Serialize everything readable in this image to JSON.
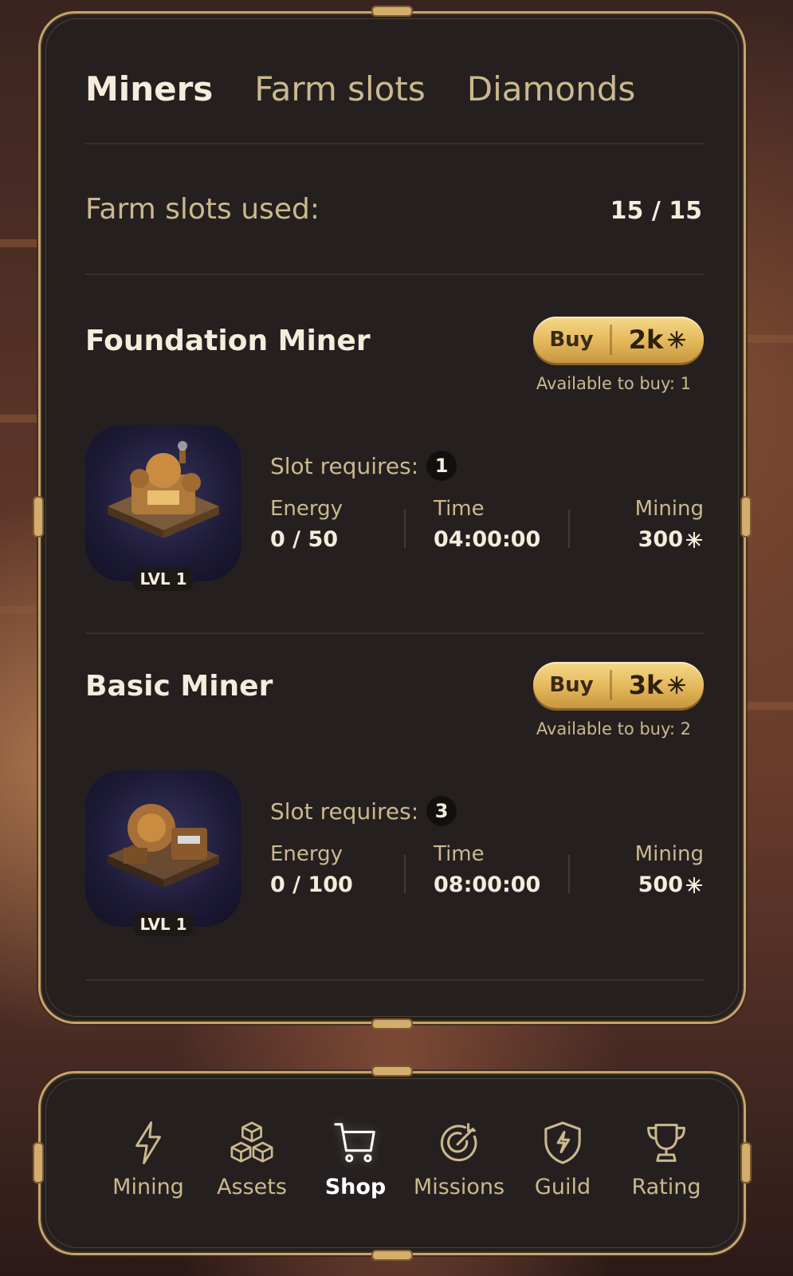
{
  "tabs": [
    {
      "label": "Miners",
      "active": true
    },
    {
      "label": "Farm slots",
      "active": false
    },
    {
      "label": "Diamonds",
      "active": false
    }
  ],
  "farm_slots": {
    "label": "Farm slots used:",
    "value": "15 / 15"
  },
  "miners": [
    {
      "name": "Foundation Miner",
      "buy_label": "Buy",
      "price": "2k",
      "available": "Available to buy: 1",
      "level": "LVL 1",
      "slot_label": "Slot requires:",
      "slot_value": "1",
      "energy_label": "Energy",
      "energy_value": "0 / 50",
      "time_label": "Time",
      "time_value": "04:00:00",
      "mining_label": "Mining",
      "mining_value": "300"
    },
    {
      "name": "Basic Miner",
      "buy_label": "Buy",
      "price": "3k",
      "available": "Available to buy: 2",
      "level": "LVL 1",
      "slot_label": "Slot requires:",
      "slot_value": "3",
      "energy_label": "Energy",
      "energy_value": "0 / 100",
      "time_label": "Time",
      "time_value": "08:00:00",
      "mining_label": "Mining",
      "mining_value": "500"
    }
  ],
  "nav": [
    {
      "label": "Mining",
      "icon": "lightning-icon",
      "active": false
    },
    {
      "label": "Assets",
      "icon": "cubes-icon",
      "active": false
    },
    {
      "label": "Shop",
      "icon": "cart-icon",
      "active": true
    },
    {
      "label": "Missions",
      "icon": "target-icon",
      "active": false
    },
    {
      "label": "Guild",
      "icon": "shield-icon",
      "active": false
    },
    {
      "label": "Rating",
      "icon": "trophy-icon",
      "active": false
    }
  ],
  "colors": {
    "accent_gold": "#e3b75a",
    "panel_bg": "#25201f",
    "text_muted": "#cbb88e",
    "text_primary": "#f5ecdc"
  }
}
